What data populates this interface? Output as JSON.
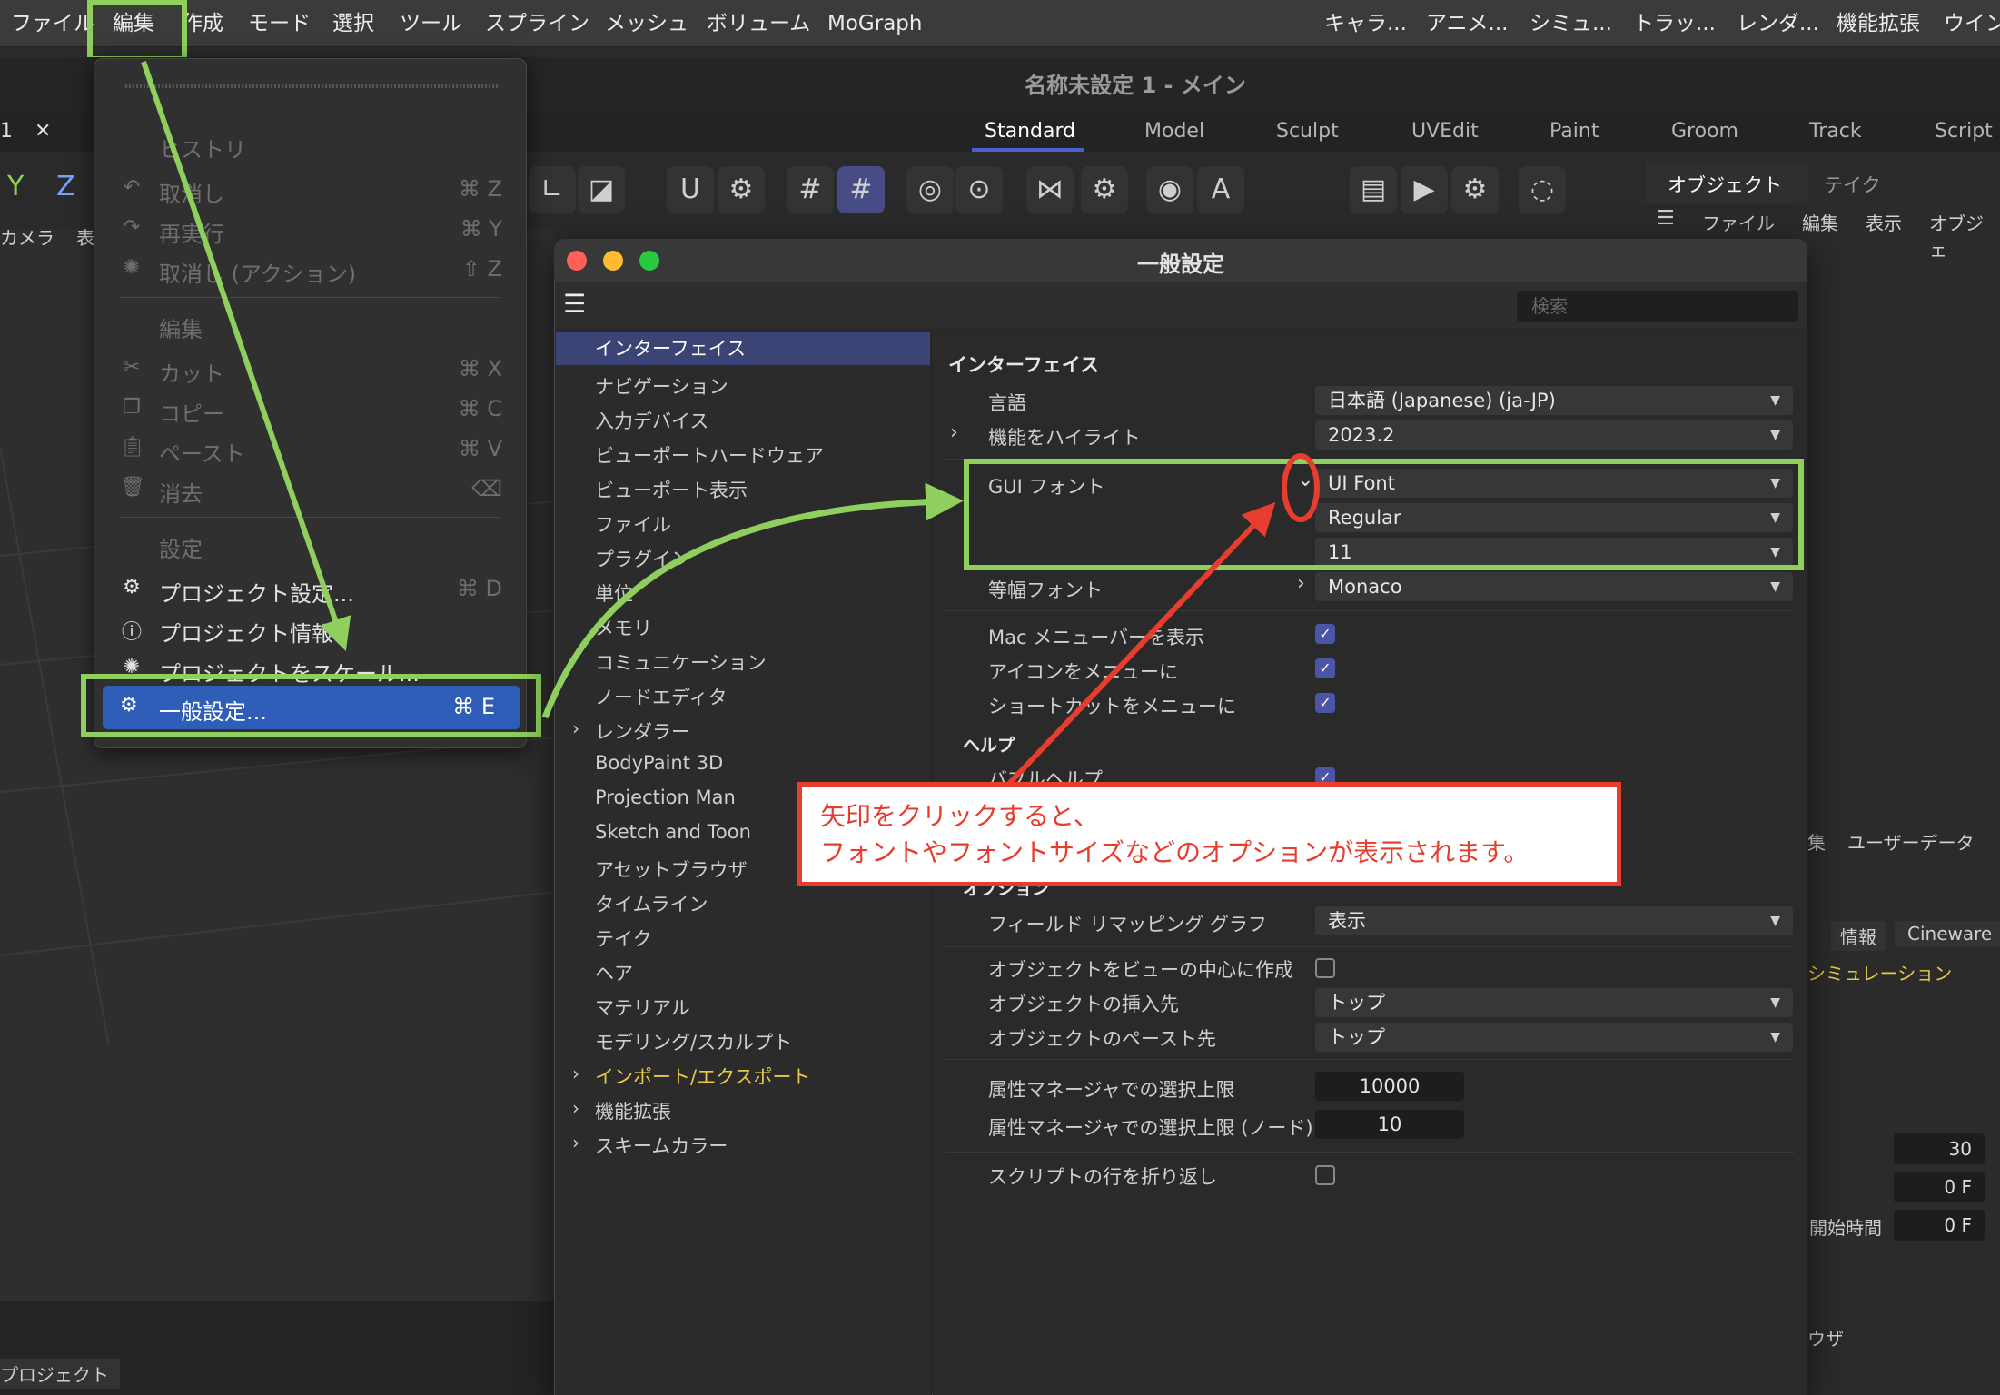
{
  "menubar": {
    "items": [
      "ファイル",
      "編集",
      "作成",
      "モード",
      "選択",
      "ツール",
      "スプライン",
      "メッシュ",
      "ボリューム",
      "MoGraph"
    ],
    "right_items": [
      "キャラ...",
      "アニメ...",
      "シミュ...",
      "トラッ...",
      "レンダ...",
      "機能拡張",
      "ウイン"
    ]
  },
  "app_title": "名称未設定 1 - メイン",
  "layout_tabs": [
    "Standard",
    "Model",
    "Sculpt",
    "UVEdit",
    "Paint",
    "Groom",
    "Track",
    "Script"
  ],
  "viewport": {
    "tab_label": "1",
    "axis_y": "Y",
    "axis_z": "Z",
    "camera_label": "カメラ",
    "view_label": "表",
    "bottom_label": "プロジェクト"
  },
  "edit_menu": {
    "history_header": "ヒストリ",
    "undo": {
      "label": "取消し",
      "shortcut": "⌘ Z"
    },
    "redo": {
      "label": "再実行",
      "shortcut": "⌘ Y"
    },
    "undo_action": {
      "label": "取消し (アクション)",
      "shortcut": "⇧ Z"
    },
    "edit_header": "編集",
    "cut": {
      "label": "カット",
      "shortcut": "⌘ X"
    },
    "copy": {
      "label": "コピー",
      "shortcut": "⌘ C"
    },
    "paste": {
      "label": "ペースト",
      "shortcut": "⌘ V"
    },
    "delete": {
      "label": "消去",
      "shortcut": "⌫"
    },
    "settings_header": "設定",
    "project_settings": {
      "label": "プロジェクト設定...",
      "shortcut": "⌘ D"
    },
    "project_info": {
      "label": "プロジェクト情報"
    },
    "project_scale": {
      "label": "プロジェクトをスケール..."
    },
    "preferences": {
      "label": "一般設定...",
      "shortcut": "⌘ E"
    }
  },
  "dialog": {
    "title": "一般設定",
    "search_placeholder": "検索",
    "nav": [
      "インターフェイス",
      "ナビゲーション",
      "入力デバイス",
      "ビューポートハードウェア",
      "ビューポート表示",
      "ファイル",
      "プラグイン",
      "単位",
      "メモリ",
      "コミュニケーション",
      "ノードエディタ",
      "レンダラー",
      "BodyPaint 3D",
      "Projection Man",
      "Sketch and Toon",
      "アセットブラウザ",
      "タイムライン",
      "テイク",
      "ヘア",
      "マテリアル",
      "モデリング/スカルプト",
      "インポート/エクスポート",
      "機能拡張",
      "スキームカラー"
    ],
    "section_title": "インターフェイス",
    "language_label": "言語",
    "language_value": "日本語 (Japanese) (ja-JP)",
    "highlight_label": "機能をハイライト",
    "highlight_value": "2023.2",
    "gui_font_label": "GUI フォント",
    "gui_font_value": "UI Font",
    "gui_font_style": "Regular",
    "gui_font_size": "11",
    "mono_font_label": "等幅フォント",
    "mono_font_value": "Monaco",
    "mac_menubar_label": "Mac メニューバーを表示",
    "icons_in_menu_label": "アイコンをメニューに",
    "shortcuts_in_menu_label": "ショートカットをメニューに",
    "help_header": "ヘルプ",
    "bubble_help_label": "バブルヘルプ",
    "options_header": "オプション",
    "field_remap_label": "フィールド リマッピング グラフ",
    "field_remap_value": "表示",
    "create_at_center_label": "オブジェクトをビューの中心に作成",
    "insert_pos_label": "オブジェクトの挿入先",
    "insert_pos_value": "トップ",
    "paste_pos_label": "オブジェクトのペースト先",
    "paste_pos_value": "トップ",
    "attr_limit_label": "属性マネージャでの選択上限",
    "attr_limit_value": "10000",
    "attr_limit_node_label": "属性マネージャでの選択上限 (ノード)",
    "attr_limit_node_value": "10",
    "script_wrap_label": "スクリプトの行を折り返し"
  },
  "right_panel": {
    "tab_objects": "オブジェクト",
    "tab_takes": "テイク",
    "menu": [
      "ファイル",
      "編集",
      "表示",
      "オブジェ"
    ],
    "edit_short": "集",
    "user_data": "ユーザーデータ",
    "info": "情報",
    "cineware": "Cineware",
    "simulation": "シミュレーション",
    "fps_value": "30",
    "frame_value": "0 F",
    "start_time_label": "開始時間",
    "start_time_value": "0 F",
    "browser_label": "ウザ"
  },
  "annotation": {
    "line1": "矢印をクリックすると、",
    "line2": "フォントやフォントサイズなどのオプションが表示されます。"
  },
  "colors": {
    "highlight_green": "#8fcf5e",
    "callout_red": "#e63d2e",
    "selection_blue": "#2f5eb8",
    "nav_selected": "#3c4476"
  }
}
